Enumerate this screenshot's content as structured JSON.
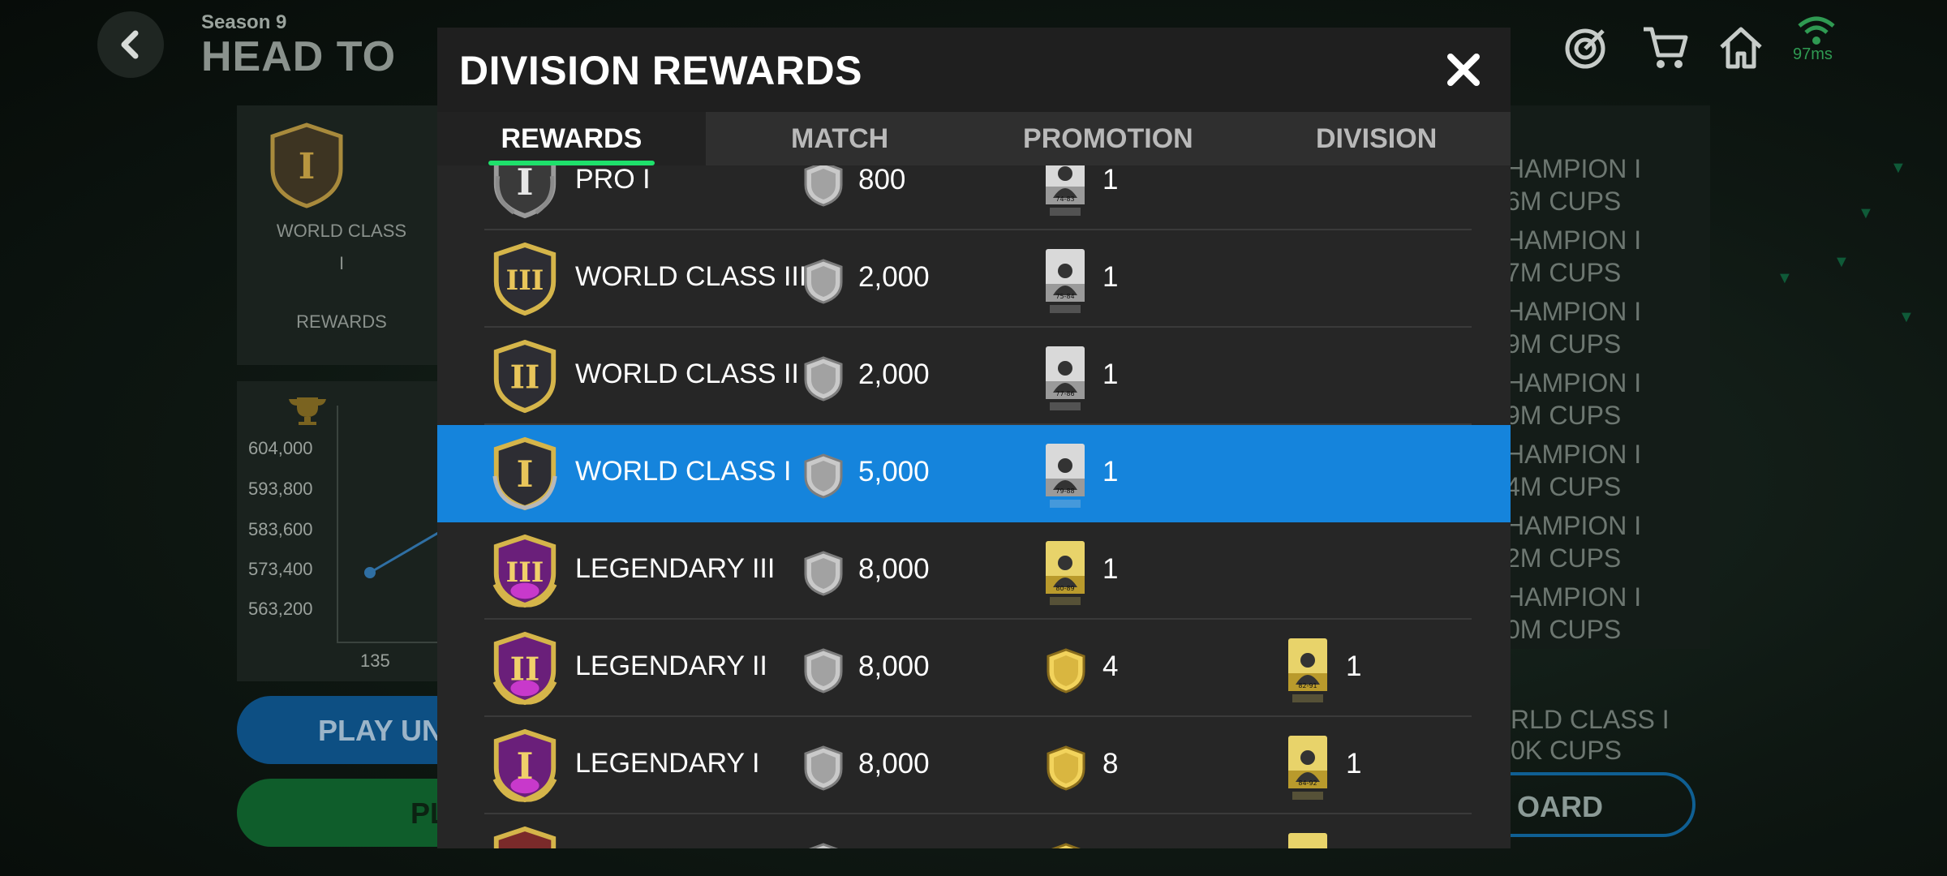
{
  "background": {
    "season_label": "Season 9",
    "mode_title": "HEAD TO",
    "ping": "97ms",
    "rank_panel": {
      "rank_line1": "WORLD CLASS",
      "rank_line2": "I",
      "rewards_label": "REWARDS"
    },
    "graph": {
      "y_ticks": [
        "604,000",
        "593,800",
        "583,600",
        "573,400",
        "563,200"
      ],
      "x_tick": "135"
    },
    "play_button": "PLAY UN",
    "green_button": "PL",
    "right_list": [
      {
        "line1": "HAMPION I",
        "line2": "6M CUPS"
      },
      {
        "line1": "HAMPION I",
        "line2": "7M CUPS"
      },
      {
        "line1": "HAMPION I",
        "line2": "9M CUPS"
      },
      {
        "line1": "HAMPION I",
        "line2": "9M CUPS"
      },
      {
        "line1": "HAMPION I",
        "line2": "4M CUPS"
      },
      {
        "line1": "HAMPION I",
        "line2": "2M CUPS"
      },
      {
        "line1": "HAMPION I",
        "line2": "0M CUPS"
      }
    ],
    "right_bottom": {
      "line1": "RLD CLASS I",
      "line2": "0K CUPS"
    },
    "leaderboard_button": "OARD",
    "icons": [
      "back-icon",
      "target-icon",
      "cart-icon",
      "home-icon",
      "wifi-icon"
    ]
  },
  "modal": {
    "title": "DIVISION REWARDS",
    "tabs": [
      {
        "label": "REWARDS",
        "active": true
      },
      {
        "label": "MATCH",
        "active": false
      },
      {
        "label": "PROMOTION",
        "active": false
      },
      {
        "label": "DIVISION",
        "active": false
      }
    ],
    "rows": [
      {
        "name": "PRO I",
        "numeral": "I",
        "tier": "pro",
        "coins": "800",
        "player_card": {
          "rating": "74-83",
          "style": "silver"
        },
        "player_count": "1",
        "extra_card": null,
        "extra_count": "",
        "highlighted": false
      },
      {
        "name": "WORLD CLASS III",
        "numeral": "III",
        "tier": "world",
        "coins": "2,000",
        "player_card": {
          "rating": "75-84",
          "style": "silver"
        },
        "player_count": "1",
        "extra_card": null,
        "extra_count": "",
        "highlighted": false
      },
      {
        "name": "WORLD CLASS II",
        "numeral": "II",
        "tier": "world",
        "coins": "2,000",
        "player_card": {
          "rating": "77-86",
          "style": "silver"
        },
        "player_count": "1",
        "extra_card": null,
        "extra_count": "",
        "highlighted": false
      },
      {
        "name": "WORLD CLASS I",
        "numeral": "I",
        "tier": "world",
        "coins": "5,000",
        "player_card": {
          "rating": "79-88",
          "style": "silver"
        },
        "player_count": "1",
        "extra_card": null,
        "extra_count": "",
        "highlighted": true
      },
      {
        "name": "LEGENDARY III",
        "numeral": "III",
        "tier": "legend",
        "coins": "8,000",
        "player_card": {
          "rating": "80-89",
          "style": "gold"
        },
        "player_count": "1",
        "extra_card": null,
        "extra_count": "",
        "highlighted": false
      },
      {
        "name": "LEGENDARY II",
        "numeral": "II",
        "tier": "legend",
        "coins": "8,000",
        "player_card": null,
        "shield_count": "4",
        "extra_card": {
          "rating": "82-91",
          "style": "gold"
        },
        "extra_count": "1",
        "highlighted": false
      },
      {
        "name": "LEGENDARY I",
        "numeral": "I",
        "tier": "legend",
        "coins": "8,000",
        "player_card": null,
        "shield_count": "8",
        "extra_card": {
          "rating": "84-92",
          "style": "gold"
        },
        "extra_count": "1",
        "highlighted": false
      }
    ],
    "colors": {
      "highlight": "#1584dc",
      "tab_indicator": "#1ee06b",
      "panel": "#262626",
      "header": "#1f1f1f"
    }
  }
}
